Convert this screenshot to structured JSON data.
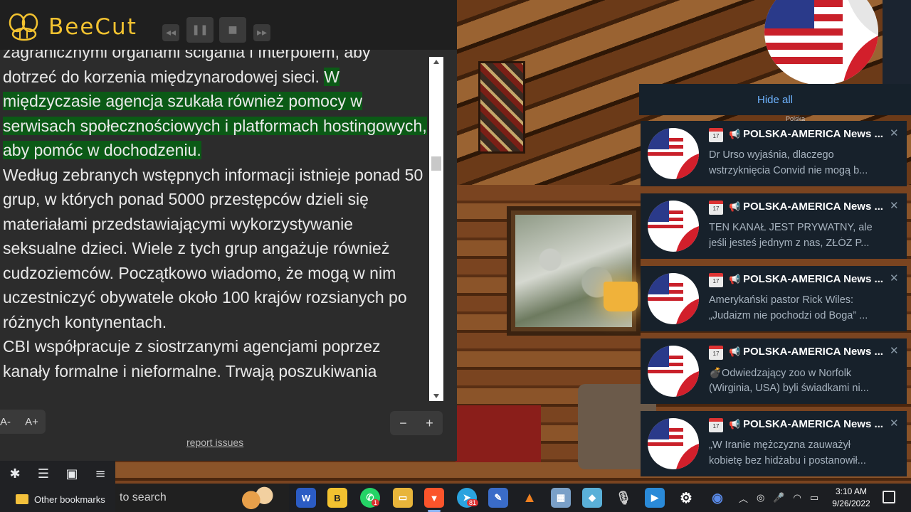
{
  "app": {
    "logo_text": "BeeCut"
  },
  "reader": {
    "paragraphs": [
      {
        "normal_pre": "zagranicznymi organami ścigania i Interpolem, aby dotrzeć do korzenia międzynarodowej sieci. ",
        "highlight": "W międzyczasie agencja szukała również pomocy w serwisach społecznościowych i platformach hostingowych, aby pomóc w dochodzeniu.",
        "normal_post": ""
      },
      {
        "normal_pre": "Według zebranych wstępnych informacji istnieje ponad 50 grup, w których ponad 5000 przestępców dzieli się materiałami przedstawiającymi wykorzystywanie seksualne dzieci. Wiele z tych grup angażuje również cudzoziemców. Początkowo wiadomo, że mogą w nim uczestniczyć obywatele około 100 krajów rozsianych po różnych kontynentach.",
        "highlight": "",
        "normal_post": ""
      },
      {
        "normal_pre": "CBI współpracuje z siostrzanymi agencjami poprzez kanały formalne i nieformalne. Trwają poszukiwania",
        "highlight": "",
        "normal_post": ""
      }
    ],
    "font_decrease": "A-",
    "font_increase": "A+",
    "zoom_minus": "−",
    "zoom_plus": "+",
    "report_link": "report issues"
  },
  "notifications": {
    "hide_all": "Hide all",
    "peek_text": "Polska",
    "items": [
      {
        "title": "POLSKA-AMERICA News ...",
        "line1": "Dr Urso wyjaśnia, dlaczego",
        "line2": "wstrzyknięcia Convid nie mogą b..."
      },
      {
        "title": "POLSKA-AMERICA News ...",
        "line1": "TEN KANAŁ JEST PRYWATNY, ale",
        "line2": "jeśli jesteś jednym z nas, ZŁÓŻ P..."
      },
      {
        "title": "POLSKA-AMERICA News ...",
        "line1": "Amerykański pastor Rick Wiles:",
        "line2": "„Judaizm nie pochodzi od Boga” ..."
      },
      {
        "title": "POLSKA-AMERICA News ...",
        "line1": "💣Odwiedzający zoo w Norfolk",
        "line2": "(Wirginia, USA) byli świadkami ni..."
      },
      {
        "title": "POLSKA-AMERICA News ...",
        "line1": "„W Iranie mężczyzna zauważył",
        "line2": "kobietę bez hidżabu i postanowił..."
      }
    ]
  },
  "browser": {
    "bookmarks_label": "Other bookmarks"
  },
  "taskbar": {
    "search_text": "to search",
    "telegram_badge": "81",
    "whatsapp_badge": "1",
    "time": "3:10 AM",
    "date": "9/26/2022"
  },
  "colors": {
    "highlight": "#0b5a16",
    "logo": "#f2c230",
    "link": "#6eb3ff"
  }
}
